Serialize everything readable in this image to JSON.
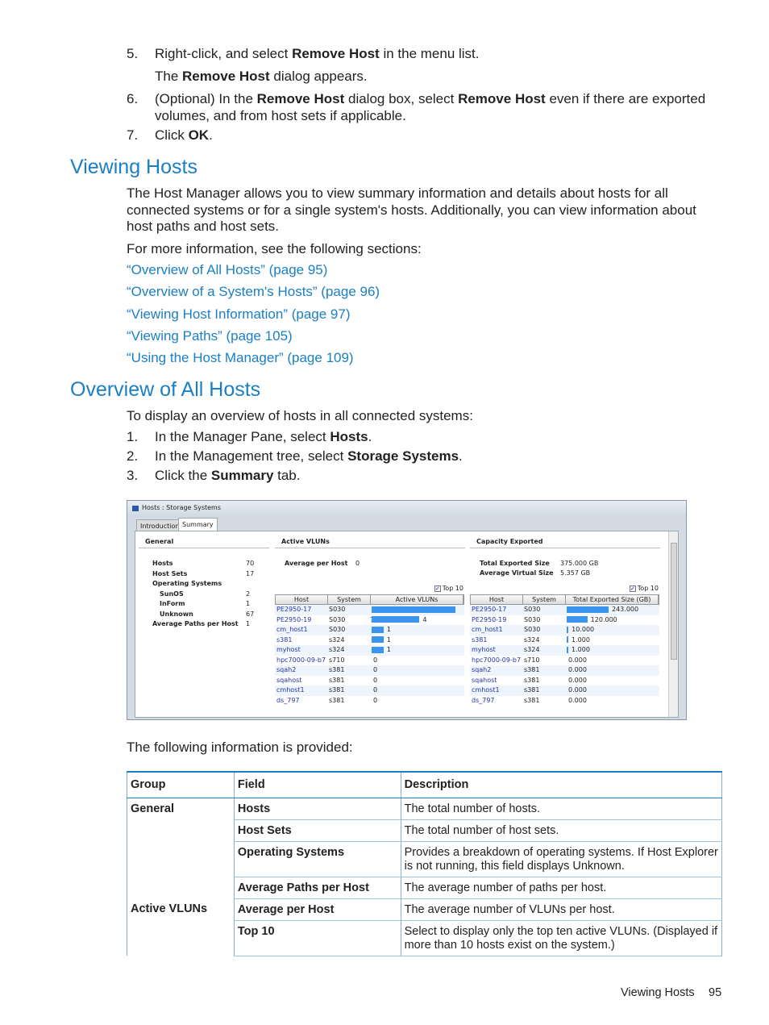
{
  "steps_top": [
    {
      "num": "5.",
      "segments": [
        {
          "t": "Right-click, and select "
        },
        {
          "t": "Remove Host",
          "b": true
        },
        {
          "t": " in the menu list."
        }
      ],
      "sub": [
        {
          "t": "The "
        },
        {
          "t": "Remove Host",
          "b": true
        },
        {
          "t": " dialog appears."
        }
      ]
    },
    {
      "num": "6.",
      "segments": [
        {
          "t": "(Optional) In the "
        },
        {
          "t": "Remove Host",
          "b": true
        },
        {
          "t": " dialog box, select "
        },
        {
          "t": "Remove Host",
          "b": true
        },
        {
          "t": " even if there are exported volumes, and from host sets if applicable."
        }
      ]
    },
    {
      "num": "7.",
      "segments": [
        {
          "t": "Click "
        },
        {
          "t": "OK",
          "b": true
        },
        {
          "t": "."
        }
      ]
    }
  ],
  "viewing_hosts": {
    "heading": "Viewing Hosts",
    "para": "The Host Manager allows you to view summary information and details about hosts for all connected systems or for a single system's hosts. Additionally, you can view information about host paths and host sets.",
    "more": "For more information, see the following sections:",
    "links": [
      "“Overview of All Hosts” (page 95)",
      "“Overview of a System's Hosts” (page 96)",
      "“Viewing Host Information” (page 97)",
      "“Viewing Paths” (page 105)",
      "“Using the Host Manager” (page 109)"
    ]
  },
  "overview": {
    "heading": "Overview of All Hosts",
    "intro": "To display an overview of hosts in all connected systems:",
    "steps": [
      {
        "num": "1.",
        "segments": [
          {
            "t": "In the Manager Pane, select "
          },
          {
            "t": "Hosts",
            "b": true
          },
          {
            "t": "."
          }
        ]
      },
      {
        "num": "2.",
        "segments": [
          {
            "t": "In the Management tree, select "
          },
          {
            "t": "Storage Systems",
            "b": true
          },
          {
            "t": "."
          }
        ]
      },
      {
        "num": "3.",
        "segments": [
          {
            "t": "Click the "
          },
          {
            "t": "Summary",
            "b": true
          },
          {
            "t": " tab."
          }
        ]
      }
    ]
  },
  "screenshot": {
    "title": "Hosts : Storage Systems",
    "tabs": [
      "Introduction",
      "Summary"
    ],
    "active_tab": "Summary",
    "general": {
      "heading": "General",
      "items": [
        {
          "label": "Hosts",
          "value": "70"
        },
        {
          "label": "Host Sets",
          "value": "17"
        },
        {
          "label": "Operating Systems",
          "value": ""
        },
        {
          "label": "SunOS",
          "value": "2",
          "indent": true
        },
        {
          "label": "InForm",
          "value": "1",
          "indent": true
        },
        {
          "label": "Unknown",
          "value": "67",
          "indent": true
        },
        {
          "label": "Average Paths per Host",
          "value": "1"
        }
      ]
    },
    "vluns": {
      "heading": "Active VLUNs",
      "avg_label": "Average per Host",
      "avg_value": "0",
      "top10": "Top 10",
      "top10_checked": true,
      "columns": [
        "Host",
        "System",
        "Active VLUNs"
      ],
      "rows": [
        [
          "PE2950-17",
          "S030",
          "7"
        ],
        [
          "PE2950-19",
          "S030",
          "4"
        ],
        [
          "cm_host1",
          "S030",
          "1"
        ],
        [
          "s381",
          "s324",
          "1"
        ],
        [
          "myhost",
          "s324",
          "1"
        ],
        [
          "hpc7000-09-b7",
          "s710",
          "0"
        ],
        [
          "sqah2",
          "s381",
          "0"
        ],
        [
          "sqahost",
          "s381",
          "0"
        ],
        [
          "cmhost1",
          "s381",
          "0"
        ],
        [
          "ds_797",
          "s381",
          "0"
        ]
      ]
    },
    "capacity": {
      "heading": "Capacity Exported",
      "total_label": "Total Exported Size",
      "total_value": "375.000 GB",
      "avg_label": "Average Virtual Size",
      "avg_value": "5.357 GB",
      "top10": "Top 10",
      "top10_checked": true,
      "columns": [
        "Host",
        "System",
        "Total Exported Size (GB)"
      ],
      "rows": [
        [
          "PE2950-17",
          "S030",
          "243.000"
        ],
        [
          "PE2950-19",
          "S030",
          "120.000"
        ],
        [
          "cm_host1",
          "S030",
          "10.000"
        ],
        [
          "s381",
          "s324",
          "1.000"
        ],
        [
          "myhost",
          "s324",
          "1.000"
        ],
        [
          "hpc7000-09-b7",
          "s710",
          "0.000"
        ],
        [
          "sqah2",
          "s381",
          "0.000"
        ],
        [
          "sqahost",
          "s381",
          "0.000"
        ],
        [
          "cmhost1",
          "s381",
          "0.000"
        ],
        [
          "ds_797",
          "s381",
          "0.000"
        ]
      ]
    },
    "bar_color": "#3b95ee"
  },
  "following": "The following information is provided:",
  "info_table": {
    "columns": [
      "Group",
      "Field",
      "Description"
    ],
    "groups": [
      {
        "group": "General",
        "rows": [
          [
            "Hosts",
            "The total number of hosts."
          ],
          [
            "Host Sets",
            "The total number of host sets."
          ],
          [
            "Operating Systems",
            "Provides a breakdown of operating systems. If Host Explorer is not running, this field displays Unknown."
          ],
          [
            "Average Paths per Host",
            "The average number of paths per host."
          ]
        ]
      },
      {
        "group": "Active VLUNs",
        "rows": [
          [
            "Average per Host",
            "The average number of VLUNs per host."
          ],
          [
            "Top 10",
            "Select to display only the top ten active VLUNs. (Displayed if more than 10 hosts exist on the system.)"
          ]
        ]
      }
    ]
  },
  "footer": {
    "section": "Viewing Hosts",
    "page": "95"
  },
  "accent": "#1a7fc4"
}
